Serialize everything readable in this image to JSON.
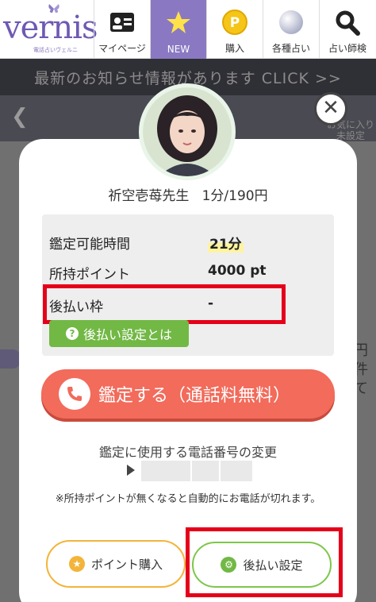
{
  "header": {
    "logo_text": "vernis",
    "logo_sub": "電話占いヴェルニ",
    "nav": [
      {
        "label": "マイページ",
        "icon": "id-card-icon"
      },
      {
        "label": "NEW",
        "icon": "star-icon"
      },
      {
        "label": "購入",
        "icon": "coin-icon"
      },
      {
        "label": "各種占い",
        "icon": "crystal-ball-icon"
      },
      {
        "label": "占い師検",
        "icon": "search-icon"
      }
    ]
  },
  "background": {
    "news": "最新のお知らせ情報があります CLICK >>",
    "fav_line1": "お気に入り",
    "fav_line2": "未設定",
    "right_text": [
      "円",
      "件",
      "て"
    ]
  },
  "modal": {
    "teacher_name": "祈空壱苺先生",
    "rate": "1分/190円",
    "rows": [
      {
        "label": "鑑定可能時間",
        "value": "21分"
      },
      {
        "label": "所持ポイント",
        "value": "4000 pt"
      },
      {
        "label": "後払い枠",
        "value": "-"
      }
    ],
    "later_info_btn": "後払い設定とは",
    "call_btn": "鑑定する（通話料無料）",
    "phone_change": "鑑定に使用する電話番号の変更",
    "note": "※所持ポイントが無くなると自動的にお電話が切れます。",
    "point_btn": "ポイント購入",
    "later_btn": "後払い設定"
  },
  "colors": {
    "brand": "#8a79c2",
    "call": "#f26b5b",
    "green": "#72b845",
    "highlight_box": "#e5001a",
    "point_border": "#f3b43a"
  }
}
